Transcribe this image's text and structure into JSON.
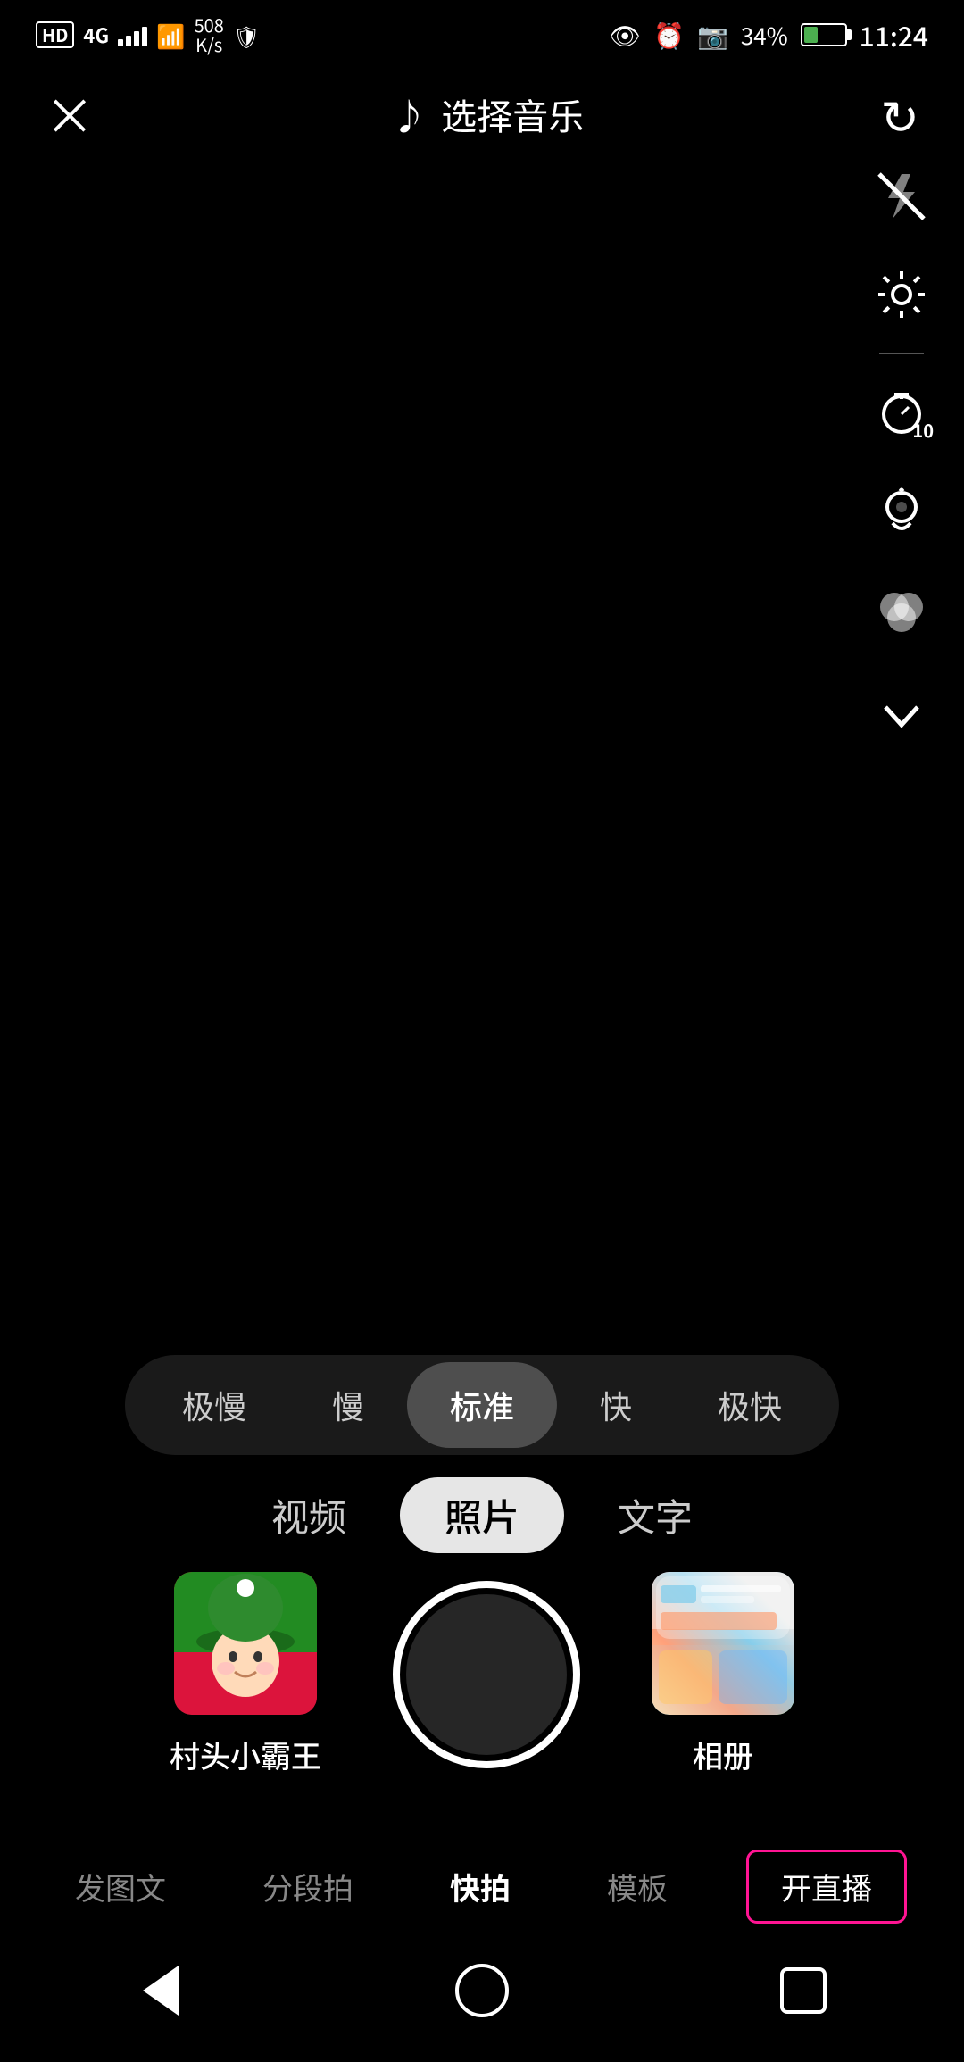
{
  "statusBar": {
    "hd": "HD",
    "network": "4G",
    "speed": "508\nK/s",
    "battery_pct": "34%",
    "time": "11:24"
  },
  "header": {
    "close_label": "×",
    "music_icon": "♪",
    "title": "选择音乐",
    "refresh_icon": "↻"
  },
  "rightSidebar": {
    "icons": [
      {
        "name": "flash-off-icon",
        "label": "flash off"
      },
      {
        "name": "settings-icon",
        "label": "settings"
      },
      {
        "name": "timer-icon",
        "label": "timer 10"
      },
      {
        "name": "beauty-icon",
        "label": "beauty"
      },
      {
        "name": "filter-icon",
        "label": "filter"
      },
      {
        "name": "more-icon",
        "label": "more chevron"
      }
    ]
  },
  "speedSelector": {
    "items": [
      "极慢",
      "慢",
      "标准",
      "快",
      "极快"
    ],
    "activeIndex": 2
  },
  "modeSelector": {
    "items": [
      "视频",
      "照片",
      "文字"
    ],
    "activeIndex": 1
  },
  "bottomRow": {
    "avatar": {
      "label": "村头小霸王"
    },
    "album": {
      "label": "相册"
    }
  },
  "bottomNav": {
    "items": [
      {
        "label": "发图文",
        "active": false,
        "highlight": false
      },
      {
        "label": "分段拍",
        "active": false,
        "highlight": false
      },
      {
        "label": "快拍",
        "active": true,
        "highlight": false
      },
      {
        "label": "模板",
        "active": false,
        "highlight": false
      },
      {
        "label": "开直播",
        "active": false,
        "highlight": true
      }
    ]
  }
}
